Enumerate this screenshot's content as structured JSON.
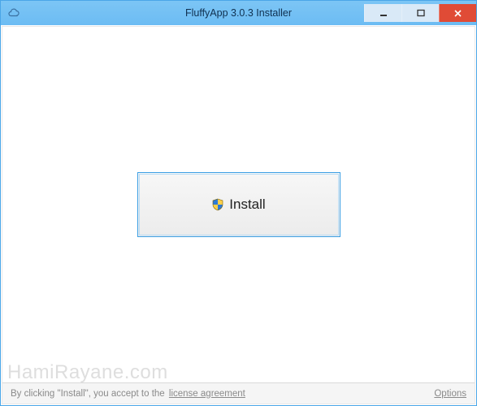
{
  "window": {
    "title": "FluffyApp 3.0.3 Installer"
  },
  "main": {
    "install_label": "Install"
  },
  "footer": {
    "agree_text": "By clicking \"Install\", you accept to the ",
    "license_link": "license agreement",
    "options_link": "Options"
  },
  "watermark": "HamiRayane.com",
  "colors": {
    "titlebar": "#6cbcf3",
    "close": "#e04b36",
    "border": "#3b9fe4"
  }
}
